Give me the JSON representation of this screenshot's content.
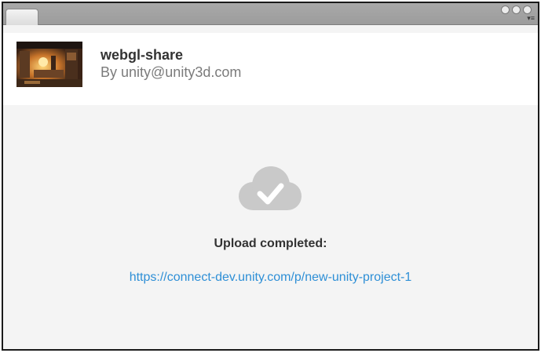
{
  "project": {
    "title": "webgl-share",
    "author": "By unity@unity3d.com"
  },
  "upload": {
    "status_text": "Upload completed:",
    "link_text": "https://connect-dev.unity.com/p/new-unity-project-1"
  },
  "icons": {
    "status": "cloud-check-icon",
    "window_menu": "menu-icon"
  },
  "colors": {
    "link": "#2e8fd6",
    "cloud": "#c9c9c9",
    "panel_background": "#f4f4f4",
    "header_background": "#ffffff"
  }
}
